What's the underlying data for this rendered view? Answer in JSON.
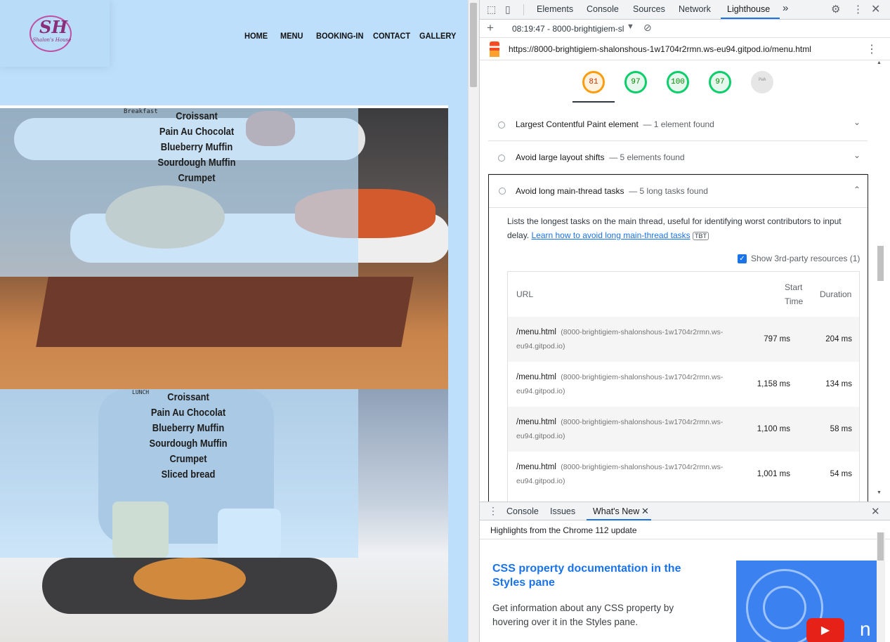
{
  "site": {
    "logo_monogram": "SH",
    "logo_caption": "Shalon's House",
    "nav": [
      "HOME",
      "MENU",
      "BOOKING-IN",
      "CONTACT",
      "GALLERY"
    ],
    "sections": [
      {
        "label": "Breakfast",
        "items": [
          "Croissant",
          "Pain Au Chocolat",
          "Blueberry Muffin",
          "Sourdough Muffin",
          "Crumpet"
        ]
      },
      {
        "label": "LUNCH",
        "items": [
          "Croissant",
          "Pain Au Chocolat",
          "Blueberry Muffin",
          "Sourdough Muffin",
          "Crumpet",
          "Sliced bread"
        ]
      }
    ]
  },
  "devtools": {
    "tabs": [
      "Elements",
      "Console",
      "Sources",
      "Network",
      "Lighthouse"
    ],
    "more": "»",
    "report_select": "08:19:47 - 8000-brightigiem-sl",
    "url": "https://8000-brightigiem-shalonshous-1w1704r2rmn.ws-eu94.gitpod.io/menu.html",
    "scores": [
      {
        "value": "81",
        "color": "#fa9d0f"
      },
      {
        "value": "97",
        "color": "#0cce6b"
      },
      {
        "value": "100",
        "color": "#0cce6b"
      },
      {
        "value": "97",
        "color": "#0cce6b"
      },
      {
        "value": "PWA",
        "color": "#c4c4c4"
      }
    ],
    "audits": [
      {
        "title": "Largest Contentful Paint element",
        "sub": "— 1 element found"
      },
      {
        "title": "Avoid large layout shifts",
        "sub": "— 5 elements found"
      },
      {
        "title": "Avoid long main-thread tasks",
        "sub": "— 5 long tasks found"
      }
    ],
    "expanded": {
      "desc": "Lists the longest tasks on the main thread, useful for identifying worst contributors to input delay.",
      "link": "Learn how to avoid long main-thread tasks",
      "badge": "TBT",
      "third_party": "Show 3rd-party resources (1)",
      "headers": {
        "url": "URL",
        "start": "Start",
        "time": "Time",
        "duration": "Duration"
      },
      "rows": [
        {
          "url": "/menu.html",
          "host": "(8000-brightigiem-shalonshous-1w1704r2rmn.ws-",
          "host2": "eu94.gitpod.io)",
          "start": "797 ms",
          "duration": "204 ms"
        },
        {
          "url": "/menu.html",
          "host": "(8000-brightigiem-shalonshous-1w1704r2rmn.ws-",
          "host2": "eu94.gitpod.io)",
          "start": "1,158 ms",
          "duration": "134 ms"
        },
        {
          "url": "/menu.html",
          "host": "(8000-brightigiem-shalonshous-1w1704r2rmn.ws-",
          "host2": "eu94.gitpod.io)",
          "start": "1,100 ms",
          "duration": "58 ms"
        },
        {
          "url": "/menu.html",
          "host": "(8000-brightigiem-shalonshous-1w1704r2rmn.ws-",
          "host2": "eu94.gitpod.io)",
          "start": "1,001 ms",
          "duration": "54 ms"
        }
      ]
    },
    "drawer": {
      "tabs": [
        "Console",
        "Issues",
        "What's New"
      ],
      "highlight": "Highlights from the Chrome 112 update",
      "article_title": "CSS property documentation in the Styles pane",
      "article_body": "Get information about any CSS property by hovering over it in the Styles pane.",
      "thumb_text": "n"
    }
  }
}
